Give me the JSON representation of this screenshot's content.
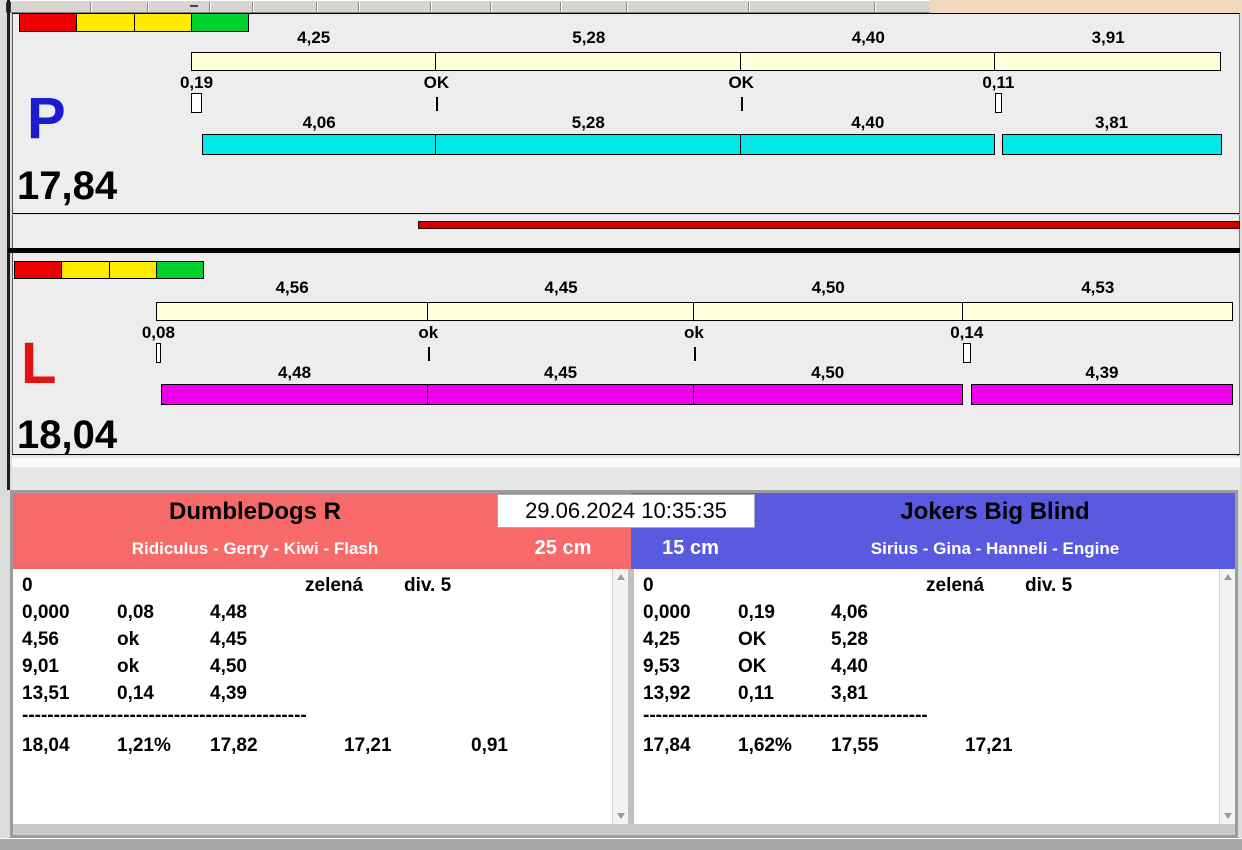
{
  "window": {
    "toolbar_color": "#D8D5D0",
    "tan_strip_color": "#F0D8BC"
  },
  "race_panels": [
    {
      "id": "P",
      "letter": "P",
      "letter_color": "#1C1CCE",
      "total": "17,84",
      "status_colors": [
        "#EE0000",
        "#FFEB00",
        "#FFEB00",
        "#00D22B"
      ],
      "split_bar_color": "#FFFFD9",
      "run_bar_color": "#00E8E8",
      "top_segments": [
        {
          "label": "4,25",
          "value": 4.25
        },
        {
          "label": "5,28",
          "value": 5.28
        },
        {
          "label": "4,40",
          "value": 4.4
        },
        {
          "label": "3,91",
          "value": 3.91
        }
      ],
      "exchanges": [
        {
          "label": "0,19",
          "value": 0.19
        },
        {
          "label": "OK"
        },
        {
          "label": "OK"
        },
        {
          "label": "0,11",
          "value": 0.11
        }
      ],
      "run_segments": [
        {
          "label": "4,06",
          "value": 4.06
        },
        {
          "label": "5,28",
          "value": 5.28
        },
        {
          "label": "4,40",
          "value": 4.4
        },
        {
          "label": "3,81",
          "value": 3.81
        }
      ]
    },
    {
      "id": "L",
      "letter": "L",
      "letter_color": "#E51212",
      "total": "18,04",
      "status_colors": [
        "#EE0000",
        "#FFEB00",
        "#FFEB00",
        "#00D22B"
      ],
      "split_bar_color": "#FFFFD9",
      "run_bar_color": "#EE00EE",
      "top_segments": [
        {
          "label": "4,56",
          "value": 4.56
        },
        {
          "label": "4,45",
          "value": 4.45
        },
        {
          "label": "4,50",
          "value": 4.5
        },
        {
          "label": "4,53",
          "value": 4.53
        }
      ],
      "exchanges": [
        {
          "label": "0,08",
          "value": 0.08
        },
        {
          "label": "ok"
        },
        {
          "label": "ok"
        },
        {
          "label": "0,14",
          "value": 0.14
        }
      ],
      "run_segments": [
        {
          "label": "4,48",
          "value": 4.48
        },
        {
          "label": "4,45",
          "value": 4.45
        },
        {
          "label": "4,50",
          "value": 4.5
        },
        {
          "label": "4,39",
          "value": 4.39
        }
      ]
    }
  ],
  "middle_bar_color": "#D00000",
  "scoreboard": {
    "datetime": "29.06.2024 10:35:35",
    "left": {
      "title": "DumbleDogs R",
      "subtitle": "Ridiculus - Gerry - Kiwi - Flash",
      "size": "25 cm",
      "header_color": "#F86A6A",
      "info_row": [
        "0",
        "zelená",
        "div. 5"
      ],
      "rows": [
        [
          "0,000",
          "0,08",
          "4,48"
        ],
        [
          "4,56",
          "ok",
          "4,45"
        ],
        [
          "9,01",
          "ok",
          "4,50"
        ],
        [
          "13,51",
          "0,14",
          "4,39"
        ]
      ],
      "divider": "---------------------------------------------",
      "total_row": [
        "18,04",
        "1,21%",
        "17,82",
        "17,21",
        "0,91"
      ]
    },
    "right": {
      "title": "Jokers Big Blind",
      "subtitle": "Sirius - Gina - Hanneli - Engine",
      "size": "15 cm",
      "header_color": "#5A5AE0",
      "info_row": [
        "0",
        "zelená",
        "div. 5"
      ],
      "rows": [
        [
          "0,000",
          "0,19",
          "4,06"
        ],
        [
          "4,25",
          "OK",
          "5,28"
        ],
        [
          "9,53",
          "OK",
          "4,40"
        ],
        [
          "13,92",
          "0,11",
          "3,81"
        ]
      ],
      "divider": "---------------------------------------------",
      "total_row": [
        "17,84",
        "1,62%",
        "17,55",
        "17,21"
      ]
    }
  }
}
